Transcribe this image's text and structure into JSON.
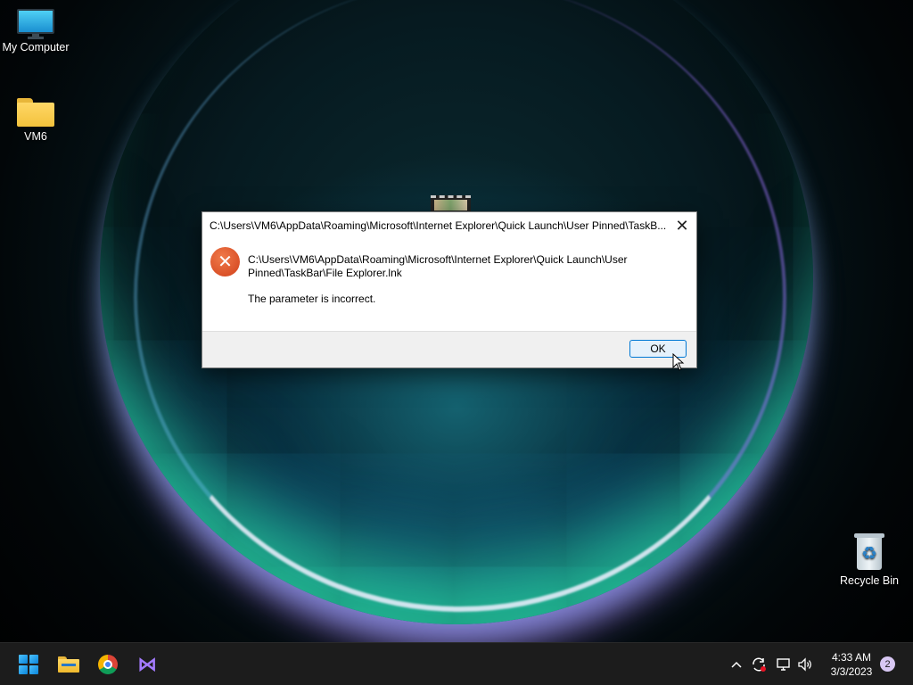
{
  "desktop": {
    "icons": [
      {
        "label": "My Computer",
        "icon": "monitor-icon"
      },
      {
        "label": "VM6",
        "icon": "folder-icon"
      },
      {
        "label": "Recycle Bin",
        "icon": "recycle-bin-icon"
      }
    ]
  },
  "dialog": {
    "title": "C:\\Users\\VM6\\AppData\\Roaming\\Microsoft\\Internet Explorer\\Quick Launch\\User Pinned\\TaskB...",
    "close_glyph": "✕",
    "error_glyph": "✕",
    "message_path": "C:\\Users\\VM6\\AppData\\Roaming\\Microsoft\\Internet Explorer\\Quick Launch\\User Pinned\\TaskBar\\File Explorer.lnk",
    "message_text": "The parameter is incorrect.",
    "ok_label": "OK"
  },
  "taskbar": {
    "apps": [
      {
        "name": "Start",
        "icon": "windows-start-icon"
      },
      {
        "name": "File Explorer",
        "icon": "file-explorer-icon"
      },
      {
        "name": "Google Chrome",
        "icon": "chrome-icon"
      },
      {
        "name": "Visual Studio",
        "icon": "visual-studio-icon"
      }
    ],
    "tray": {
      "overflow_glyph": "^",
      "time": "4:33 AM",
      "date": "3/3/2023",
      "notification_count": "2"
    }
  },
  "colors": {
    "accent": "#0078d4",
    "error": "#d1401a",
    "taskbar": "#1c1c1c"
  }
}
